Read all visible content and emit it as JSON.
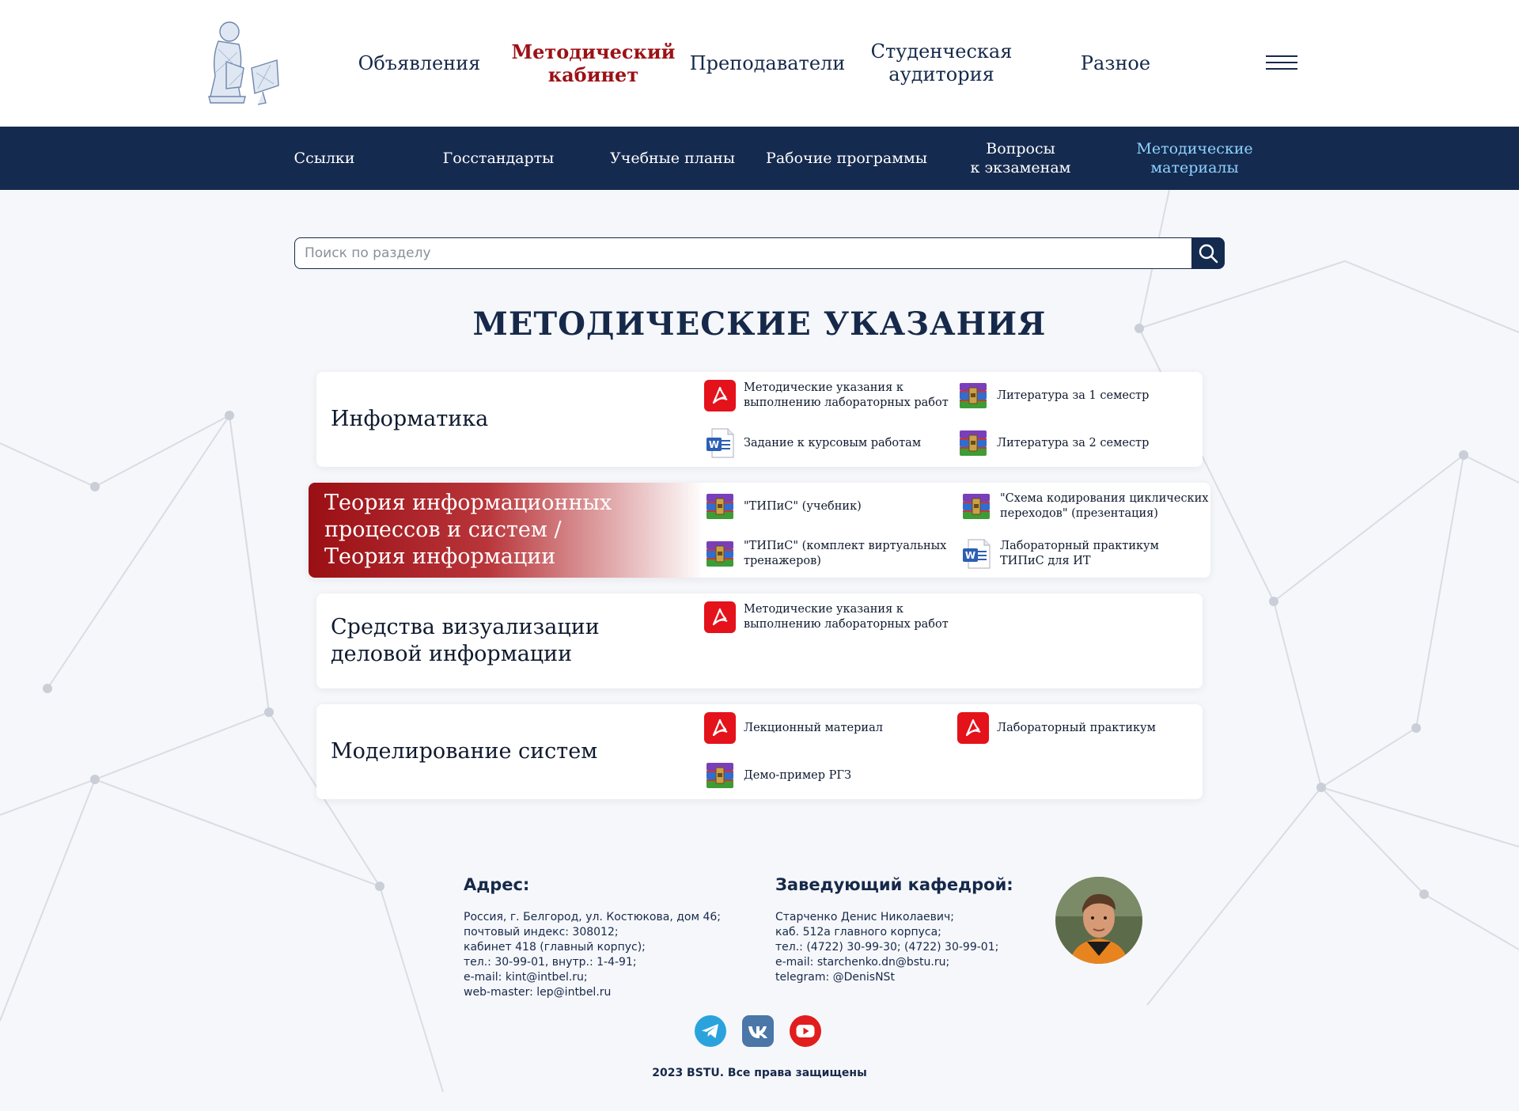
{
  "header": {
    "nav": [
      {
        "label": "Объявления",
        "active": false
      },
      {
        "label": "Методический\nкабинет",
        "active": true
      },
      {
        "label": "Преподаватели",
        "active": false
      },
      {
        "label": "Студенческая\nаудитория",
        "active": false
      },
      {
        "label": "Разное",
        "active": false
      }
    ],
    "menu_icon": "hamburger-icon"
  },
  "subnav": {
    "items": [
      {
        "label": "Ссылки"
      },
      {
        "label": "Госстандарты"
      },
      {
        "label": "Учебные планы"
      },
      {
        "label": "Рабочие программы"
      },
      {
        "label": "Вопросы\nк экзаменам"
      },
      {
        "label": "Методические\nматериалы"
      }
    ],
    "active_index": 5
  },
  "search": {
    "placeholder": "Поиск по разделу",
    "value": "",
    "icon": "search-icon"
  },
  "page": {
    "title": "МЕТОДИЧЕСКИЕ УКАЗАНИЯ"
  },
  "subjects": [
    {
      "name": "Информатика",
      "highlighted": false,
      "files": [
        {
          "label": "Методические указания к\nвыполнению лабораторных работ",
          "type": "pdf"
        },
        {
          "label": "Литература за 1 семестр",
          "type": "rar"
        },
        {
          "label": "Задание к курсовым работам",
          "type": "doc"
        },
        {
          "label": "Литература за 2 семестр",
          "type": "rar"
        }
      ]
    },
    {
      "name": "Теория информационных\nпроцессов и систем /\nТеория информации",
      "highlighted": true,
      "files": [
        {
          "label": "\"ТИПиС\" (учебник)",
          "type": "rar"
        },
        {
          "label": "\"Схема кодирования циклических\nпереходов\" (презентация)",
          "type": "rar"
        },
        {
          "label": "\"ТИПиС\" (комплект виртуальных\nтренажеров)",
          "type": "rar"
        },
        {
          "label": "Лабораторный практикум\nТИПиС для ИТ",
          "type": "doc"
        }
      ]
    },
    {
      "name": "Средства визуализации\nделовой информации",
      "highlighted": false,
      "files": [
        {
          "label": "Методические указания к\nвыполнению лабораторных работ",
          "type": "pdf"
        }
      ]
    },
    {
      "name": "Моделирование систем",
      "highlighted": false,
      "files": [
        {
          "label": "Лекционный материал",
          "type": "pdf"
        },
        {
          "label": "Лабораторный практикум",
          "type": "pdf"
        },
        {
          "label": "Демо-пример РГЗ",
          "type": "rar"
        }
      ]
    }
  ],
  "footer": {
    "address_title": "Адрес:",
    "address_text": "Россия, г. Белгород, ул. Костюкова, дом 46;\nпочтовый индекс: 308012;\nкабинет 418 (главный корпус);\nтел.: 30-99-01, внутр.: 1-4-91;\ne-mail: kint@intbel.ru;\nweb-master: lep@intbel.ru",
    "head_title": "Заведующий кафедрой:",
    "head_text": "Старченко Денис Николаевич;\nкаб. 512а главного корпуса;\nтел.: (4722) 30-99-30; (4722) 30-99-01;\ne-mail: starchenko.dn@bstu.ru;\ntelegram: @DenisNSt",
    "social": [
      {
        "icon": "telegram-icon",
        "color": "#2aa3dd"
      },
      {
        "icon": "vk-icon",
        "color": "#4a76a8"
      },
      {
        "icon": "youtube-icon",
        "color": "#e11d1d"
      }
    ],
    "copyright": "2023 BSTU. Все права защищены"
  },
  "colors": {
    "navy": "#152a4f",
    "accent_red": "#9c1116",
    "active_sub": "#8fd3ff",
    "background": "#f6f7fa"
  }
}
